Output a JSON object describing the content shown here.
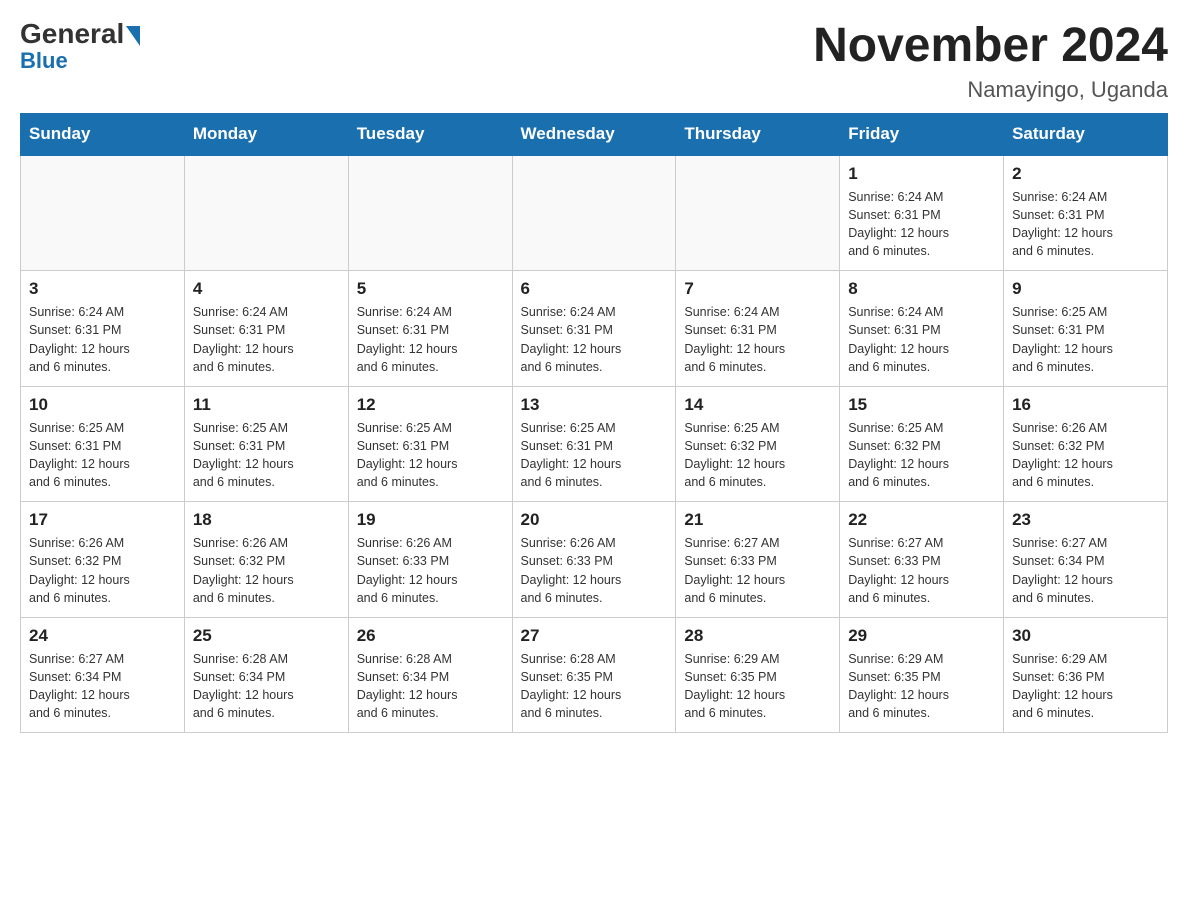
{
  "header": {
    "logo_general": "General",
    "logo_blue": "Blue",
    "title": "November 2024",
    "location": "Namayingo, Uganda"
  },
  "days_of_week": [
    "Sunday",
    "Monday",
    "Tuesday",
    "Wednesday",
    "Thursday",
    "Friday",
    "Saturday"
  ],
  "weeks": [
    [
      {
        "day": "",
        "info": ""
      },
      {
        "day": "",
        "info": ""
      },
      {
        "day": "",
        "info": ""
      },
      {
        "day": "",
        "info": ""
      },
      {
        "day": "",
        "info": ""
      },
      {
        "day": "1",
        "info": "Sunrise: 6:24 AM\nSunset: 6:31 PM\nDaylight: 12 hours\nand 6 minutes."
      },
      {
        "day": "2",
        "info": "Sunrise: 6:24 AM\nSunset: 6:31 PM\nDaylight: 12 hours\nand 6 minutes."
      }
    ],
    [
      {
        "day": "3",
        "info": "Sunrise: 6:24 AM\nSunset: 6:31 PM\nDaylight: 12 hours\nand 6 minutes."
      },
      {
        "day": "4",
        "info": "Sunrise: 6:24 AM\nSunset: 6:31 PM\nDaylight: 12 hours\nand 6 minutes."
      },
      {
        "day": "5",
        "info": "Sunrise: 6:24 AM\nSunset: 6:31 PM\nDaylight: 12 hours\nand 6 minutes."
      },
      {
        "day": "6",
        "info": "Sunrise: 6:24 AM\nSunset: 6:31 PM\nDaylight: 12 hours\nand 6 minutes."
      },
      {
        "day": "7",
        "info": "Sunrise: 6:24 AM\nSunset: 6:31 PM\nDaylight: 12 hours\nand 6 minutes."
      },
      {
        "day": "8",
        "info": "Sunrise: 6:24 AM\nSunset: 6:31 PM\nDaylight: 12 hours\nand 6 minutes."
      },
      {
        "day": "9",
        "info": "Sunrise: 6:25 AM\nSunset: 6:31 PM\nDaylight: 12 hours\nand 6 minutes."
      }
    ],
    [
      {
        "day": "10",
        "info": "Sunrise: 6:25 AM\nSunset: 6:31 PM\nDaylight: 12 hours\nand 6 minutes."
      },
      {
        "day": "11",
        "info": "Sunrise: 6:25 AM\nSunset: 6:31 PM\nDaylight: 12 hours\nand 6 minutes."
      },
      {
        "day": "12",
        "info": "Sunrise: 6:25 AM\nSunset: 6:31 PM\nDaylight: 12 hours\nand 6 minutes."
      },
      {
        "day": "13",
        "info": "Sunrise: 6:25 AM\nSunset: 6:31 PM\nDaylight: 12 hours\nand 6 minutes."
      },
      {
        "day": "14",
        "info": "Sunrise: 6:25 AM\nSunset: 6:32 PM\nDaylight: 12 hours\nand 6 minutes."
      },
      {
        "day": "15",
        "info": "Sunrise: 6:25 AM\nSunset: 6:32 PM\nDaylight: 12 hours\nand 6 minutes."
      },
      {
        "day": "16",
        "info": "Sunrise: 6:26 AM\nSunset: 6:32 PM\nDaylight: 12 hours\nand 6 minutes."
      }
    ],
    [
      {
        "day": "17",
        "info": "Sunrise: 6:26 AM\nSunset: 6:32 PM\nDaylight: 12 hours\nand 6 minutes."
      },
      {
        "day": "18",
        "info": "Sunrise: 6:26 AM\nSunset: 6:32 PM\nDaylight: 12 hours\nand 6 minutes."
      },
      {
        "day": "19",
        "info": "Sunrise: 6:26 AM\nSunset: 6:33 PM\nDaylight: 12 hours\nand 6 minutes."
      },
      {
        "day": "20",
        "info": "Sunrise: 6:26 AM\nSunset: 6:33 PM\nDaylight: 12 hours\nand 6 minutes."
      },
      {
        "day": "21",
        "info": "Sunrise: 6:27 AM\nSunset: 6:33 PM\nDaylight: 12 hours\nand 6 minutes."
      },
      {
        "day": "22",
        "info": "Sunrise: 6:27 AM\nSunset: 6:33 PM\nDaylight: 12 hours\nand 6 minutes."
      },
      {
        "day": "23",
        "info": "Sunrise: 6:27 AM\nSunset: 6:34 PM\nDaylight: 12 hours\nand 6 minutes."
      }
    ],
    [
      {
        "day": "24",
        "info": "Sunrise: 6:27 AM\nSunset: 6:34 PM\nDaylight: 12 hours\nand 6 minutes."
      },
      {
        "day": "25",
        "info": "Sunrise: 6:28 AM\nSunset: 6:34 PM\nDaylight: 12 hours\nand 6 minutes."
      },
      {
        "day": "26",
        "info": "Sunrise: 6:28 AM\nSunset: 6:34 PM\nDaylight: 12 hours\nand 6 minutes."
      },
      {
        "day": "27",
        "info": "Sunrise: 6:28 AM\nSunset: 6:35 PM\nDaylight: 12 hours\nand 6 minutes."
      },
      {
        "day": "28",
        "info": "Sunrise: 6:29 AM\nSunset: 6:35 PM\nDaylight: 12 hours\nand 6 minutes."
      },
      {
        "day": "29",
        "info": "Sunrise: 6:29 AM\nSunset: 6:35 PM\nDaylight: 12 hours\nand 6 minutes."
      },
      {
        "day": "30",
        "info": "Sunrise: 6:29 AM\nSunset: 6:36 PM\nDaylight: 12 hours\nand 6 minutes."
      }
    ]
  ]
}
